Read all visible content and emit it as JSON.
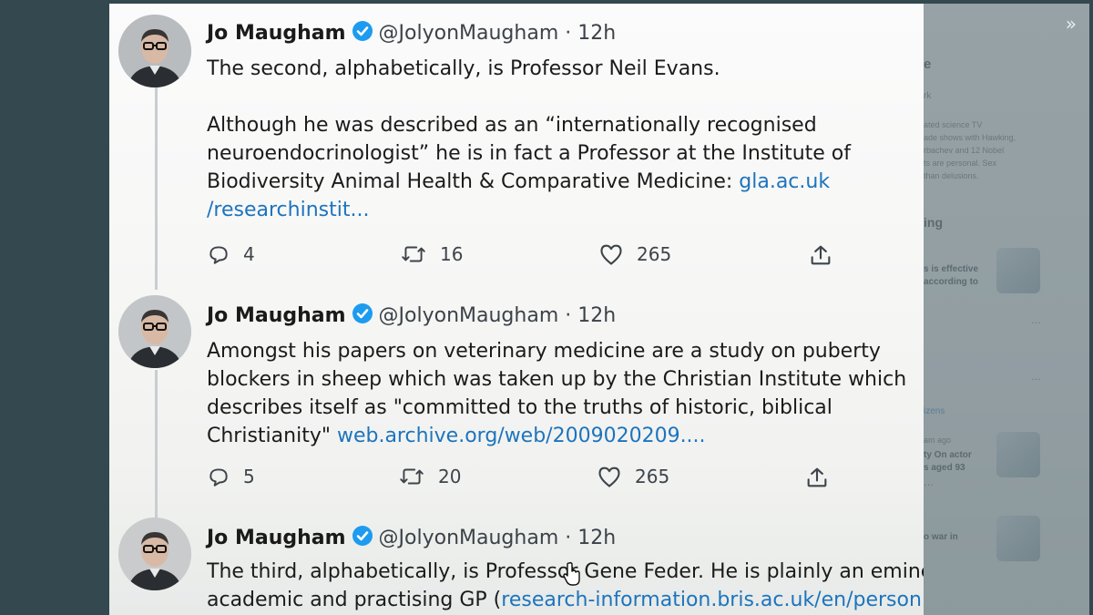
{
  "tweets": [
    {
      "name": "Jo Maugham",
      "handle": "@JolyonMaugham",
      "dot": "·",
      "time": "12h",
      "text_para1": "The second, alphabetically, is Professor Neil Evans.",
      "text_para2": "Although he was described as an “internationally recognised neuroendocrinologist” he is in fact a Professor at the Institute of Biodiversity Animal Health & Comparative Medicine: ",
      "link": "gla.ac.uk /researchinstit...",
      "replies": "4",
      "retweets": "16",
      "likes": "265"
    },
    {
      "name": "Jo Maugham",
      "handle": "@JolyonMaugham",
      "dot": "·",
      "time": "12h",
      "text": "Amongst his papers on veterinary medicine are a study on puberty blockers in sheep which was taken up by the Christian Institute which describes itself as \"committed to the truths of historic, biblical Christianity\" ",
      "link": "web.archive.org/web/2009020209....",
      "replies": "5",
      "retweets": "20",
      "likes": "265"
    },
    {
      "name": "Jo Maugham",
      "handle": "@JolyonMaugham",
      "dot": "·",
      "time": "12h",
      "text_line1": "The third, alphabetically, is Professor Gene Feder. He is plainly an emine",
      "text_line2_prefix": "academic and practising GP (",
      "link": "research-information.bris.ac.uk/en/person"
    }
  ],
  "sidebar": {
    "fragments": [
      "e",
      "rk",
      "ated science TV",
      "ade shows with Hawking,",
      "rbachev and 12 Nobel",
      "ts are personal. Sex",
      "than delusions.",
      "ing",
      "s is effective",
      "according to",
      "…",
      "…",
      "izens",
      "am ago",
      "ty On actor",
      "s aged 93",
      "…",
      "o war in"
    ]
  },
  "colors": {
    "accent": "#1d74bd",
    "verified": "#1d9bf0",
    "frame": "#33484f"
  }
}
